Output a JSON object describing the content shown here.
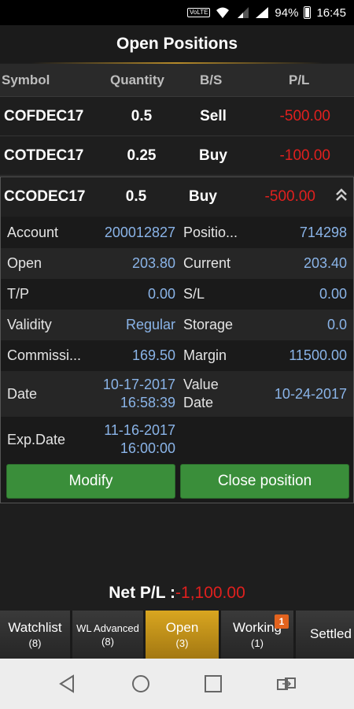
{
  "status_bar": {
    "volte": "VoLTE",
    "battery": "94%",
    "time": "16:45"
  },
  "header": {
    "title": "Open Positions"
  },
  "columns": {
    "symbol": "Symbol",
    "quantity": "Quantity",
    "bs": "B/S",
    "pl": "P/L"
  },
  "positions": [
    {
      "symbol": "COFDEC17",
      "quantity": "0.5",
      "bs": "Sell",
      "pl": "-500.00"
    },
    {
      "symbol": "COTDEC17",
      "quantity": "0.25",
      "bs": "Buy",
      "pl": "-100.00"
    },
    {
      "symbol": "CCODEC17",
      "quantity": "0.5",
      "bs": "Buy",
      "pl": "-500.00"
    }
  ],
  "details": {
    "account_label": "Account",
    "account_value": "200012827",
    "position_label": "Positio...",
    "position_value": "714298",
    "open_label": "Open",
    "open_value": "203.80",
    "current_label": "Current",
    "current_value": "203.40",
    "tp_label": "T/P",
    "tp_value": "0.00",
    "sl_label": "S/L",
    "sl_value": "0.00",
    "validity_label": "Validity",
    "validity_value": "Regular",
    "storage_label": "Storage",
    "storage_value": "0.0",
    "commission_label": "Commissi...",
    "commission_value": "169.50",
    "margin_label": "Margin",
    "margin_value": "11500.00",
    "date_label": "Date",
    "date_value_1": "10-17-2017",
    "date_value_2": "16:58:39",
    "value_date_label_1": "Value",
    "value_date_label_2": "Date",
    "value_date_value": "10-24-2017",
    "exp_date_label": "Exp.Date",
    "exp_date_value_1": "11-16-2017",
    "exp_date_value_2": "16:00:00"
  },
  "actions": {
    "modify": "Modify",
    "close": "Close position"
  },
  "net": {
    "label": "Net P/L : ",
    "value": "-1,100.00"
  },
  "tabs": [
    {
      "label": "Watchlist",
      "count": "(8)"
    },
    {
      "label": "WL Advanced",
      "count": "(8)"
    },
    {
      "label": "Open",
      "count": "(3)"
    },
    {
      "label": "Working",
      "count": "(1)",
      "badge": "1"
    },
    {
      "label": "Settled",
      "count": ""
    }
  ],
  "colors": {
    "accent": "#d9a620",
    "negative": "#e0201e",
    "value": "#8ab4e8",
    "button": "#3a8e3a",
    "badge": "#e3631e"
  },
  "icons": [
    "volte-icon",
    "wifi-icon",
    "signal-icon",
    "battery-icon",
    "chevron-up-icon",
    "back-icon",
    "home-icon",
    "recents-icon",
    "switch-icon"
  ]
}
